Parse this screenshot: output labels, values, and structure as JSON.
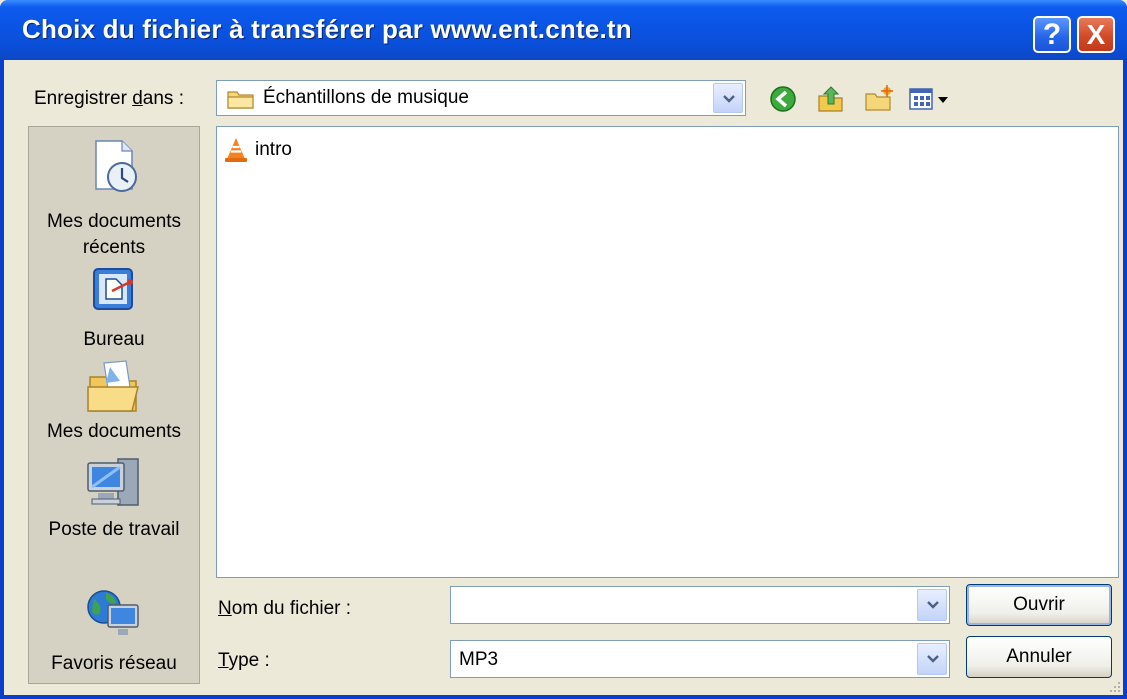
{
  "window": {
    "title": "Choix du fichier à transférer par www.ent.cnte.tn"
  },
  "titlebar_buttons": {
    "help": "?",
    "close": "X"
  },
  "look_in": {
    "label_prefix": "Enregistrer ",
    "label_accel": "d",
    "label_suffix": "ans :",
    "value": "Échantillons de musique"
  },
  "toolbar": {
    "icons": [
      "back-icon",
      "up-folder-icon",
      "new-folder-icon",
      "view-menu-icon"
    ]
  },
  "places": [
    {
      "label": "Mes documents récents",
      "icon": "recent-documents-icon"
    },
    {
      "label": "Bureau",
      "icon": "desktop-icon"
    },
    {
      "label": "Mes documents",
      "icon": "my-documents-icon"
    },
    {
      "label": "Poste de travail",
      "icon": "my-computer-icon"
    },
    {
      "label": "Favoris réseau",
      "icon": "network-places-icon"
    }
  ],
  "files": [
    {
      "name": "intro",
      "icon": "vlc-icon"
    }
  ],
  "filename": {
    "label_accel": "N",
    "label_rest": "om du fichier :",
    "value": ""
  },
  "filetype": {
    "label_accel": "T",
    "label_rest": "ype :",
    "value": "MP3"
  },
  "buttons": {
    "open": "Ouvrir",
    "cancel": "Annuler"
  },
  "colors": {
    "title_bar": "#0A54E3",
    "dialog_bg": "#ECE9D8",
    "close_button": "#D34A28",
    "places_bg": "#D5D2C3"
  }
}
